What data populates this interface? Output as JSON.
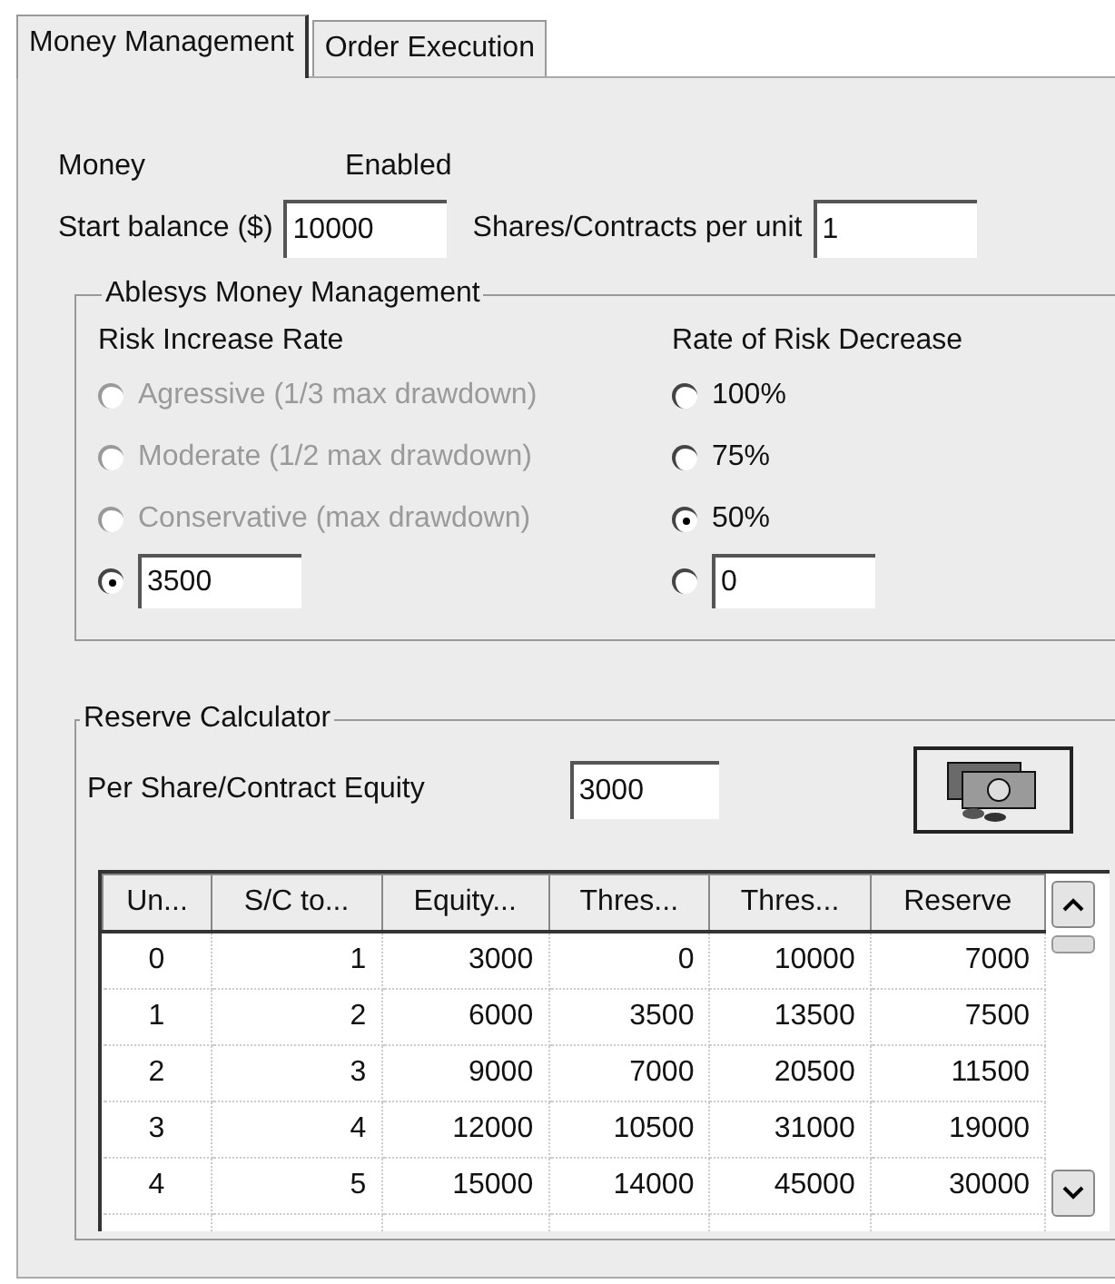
{
  "tabs": [
    {
      "label": "Money Management",
      "selected": true
    },
    {
      "label": "Order Execution",
      "selected": false
    }
  ],
  "money": {
    "label": "Money",
    "status": "Enabled"
  },
  "start_balance": {
    "label": "Start balance ($)",
    "value": "10000"
  },
  "shares_per_unit": {
    "label": "Shares/Contracts per unit",
    "value": "1"
  },
  "ablesys": {
    "title": "Ablesys Money Management",
    "risk_increase": {
      "title": "Risk Increase Rate",
      "options": [
        {
          "kind": "option",
          "label": "Agressive (1/3 max drawdown)",
          "selected": false,
          "disabled": true
        },
        {
          "kind": "option",
          "label": "Moderate (1/2 max drawdown)",
          "selected": false,
          "disabled": true
        },
        {
          "kind": "option",
          "label": "Conservative (max drawdown)",
          "selected": false,
          "disabled": true
        },
        {
          "kind": "custom",
          "value": "3500",
          "selected": true,
          "disabled": false
        }
      ]
    },
    "risk_decrease": {
      "title": "Rate of Risk Decrease",
      "options": [
        {
          "kind": "option",
          "label": "100%",
          "selected": false,
          "disabled": false
        },
        {
          "kind": "option",
          "label": "75%",
          "selected": false,
          "disabled": false
        },
        {
          "kind": "option",
          "label": "50%",
          "selected": true,
          "disabled": false
        },
        {
          "kind": "custom",
          "value": "0",
          "selected": false,
          "disabled": false
        }
      ]
    }
  },
  "reserve": {
    "title": "Reserve Calculator",
    "equity_label": "Per Share/Contract Equity",
    "equity_value": "3000",
    "table": {
      "columns": [
        "Un...",
        "S/C to...",
        "Equity...",
        "Thres...",
        "Thres...",
        "Reserve"
      ],
      "rows": [
        [
          "0",
          "1",
          "3000",
          "0",
          "10000",
          "7000"
        ],
        [
          "1",
          "2",
          "6000",
          "3500",
          "13500",
          "7500"
        ],
        [
          "2",
          "3",
          "9000",
          "7000",
          "20500",
          "11500"
        ],
        [
          "3",
          "4",
          "12000",
          "10500",
          "31000",
          "19000"
        ],
        [
          "4",
          "5",
          "15000",
          "14000",
          "45000",
          "30000"
        ]
      ]
    }
  }
}
